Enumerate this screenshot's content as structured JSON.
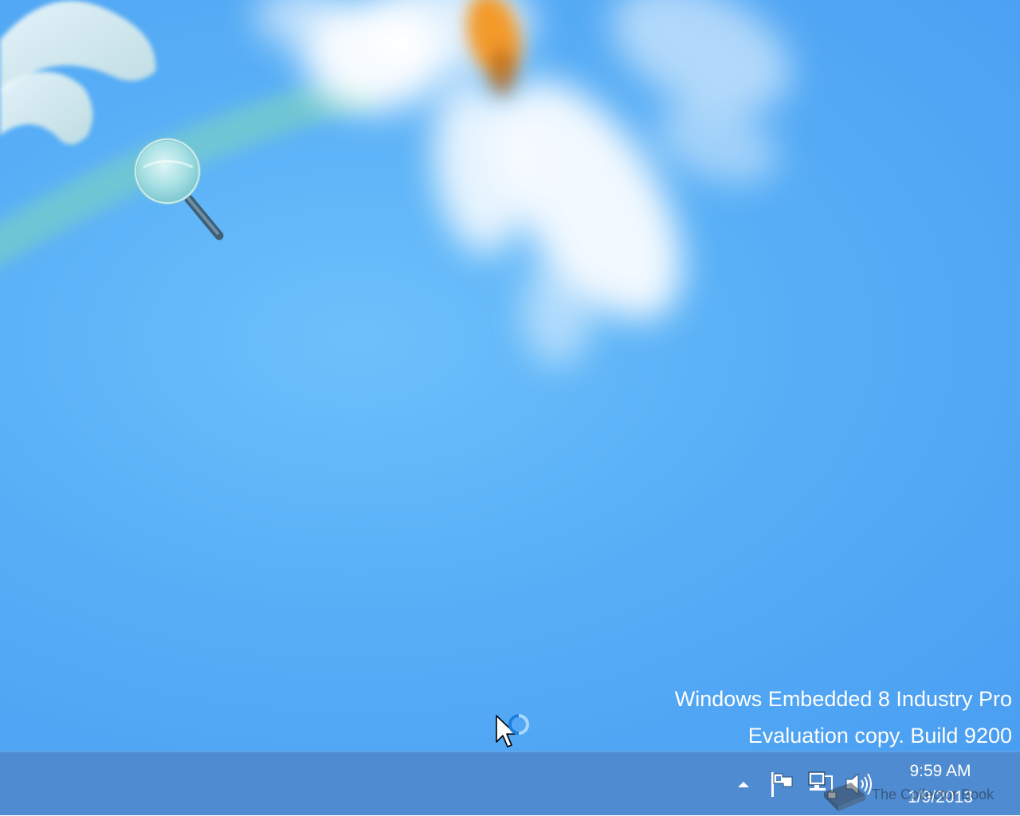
{
  "desktop": {
    "wallpaper": "blue-flower-wallpaper",
    "colors": {
      "sky": "#58aff6",
      "petal": "#ffffff",
      "flower_center": "#f39a2a",
      "stem": "#7fd1b0"
    },
    "icon": {
      "name": "search-icon",
      "label": ""
    }
  },
  "watermark": {
    "edition": "Windows Embedded 8 Industry Pro",
    "build": "Evaluation copy. Build 9200"
  },
  "taskbar": {
    "color": "#4f8bd0",
    "tray": {
      "show_hidden_icon": "up-arrow-icon",
      "action_center_icon": "flag-icon",
      "network_icon": "network-icon",
      "volume_icon": "speaker-icon"
    },
    "clock": {
      "time": "9:59 AM",
      "date": "1/9/2013"
    }
  },
  "overlay": {
    "credit": "The Collector Book"
  },
  "cursor": {
    "state": "busy"
  }
}
